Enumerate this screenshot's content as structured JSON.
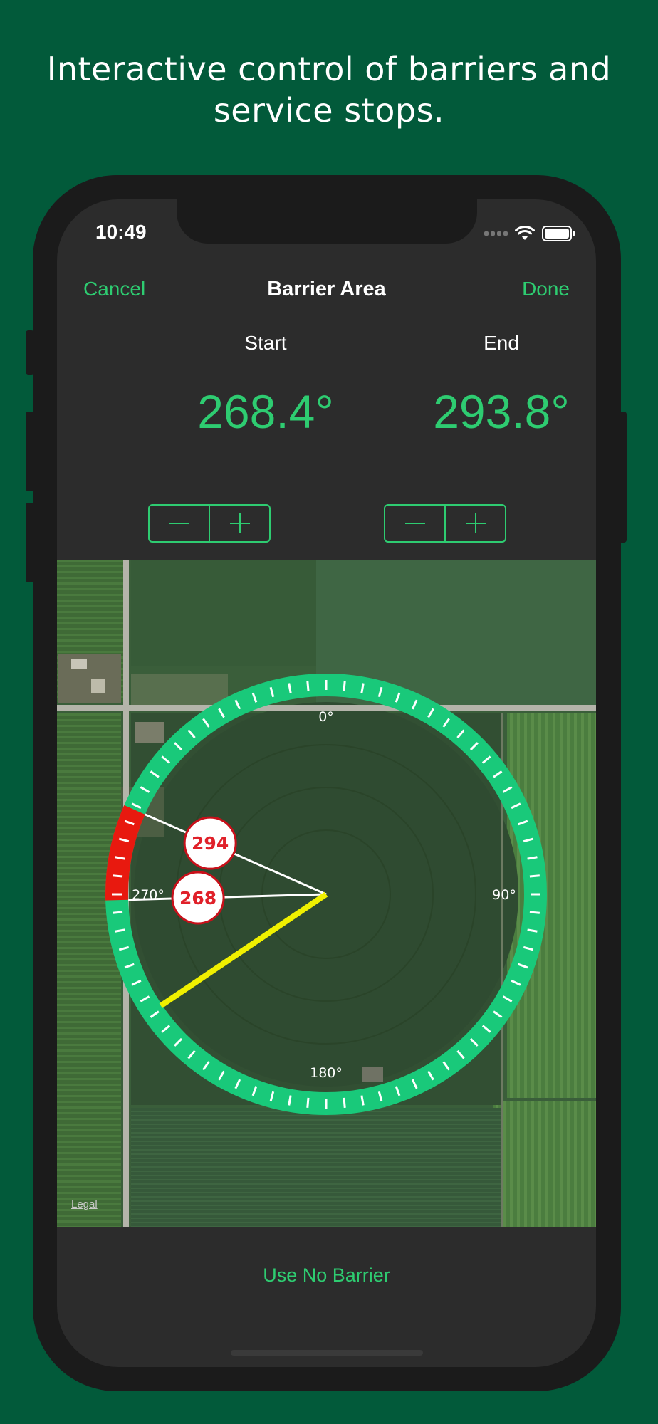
{
  "headline": "Interactive control of barriers and service stops.",
  "status_bar": {
    "time": "10:49"
  },
  "navbar": {
    "cancel": "Cancel",
    "title": "Barrier Area",
    "done": "Done"
  },
  "start": {
    "label": "Start",
    "value": "268.4°"
  },
  "end": {
    "label": "End",
    "value": "293.8°"
  },
  "dial": {
    "label_0": "0°",
    "label_90": "90°",
    "label_180": "180°",
    "label_270": "270°",
    "start_marker": "268",
    "end_marker": "294",
    "current_angle": 236
  },
  "map": {
    "legal": "Legal"
  },
  "bottom_button": "Use No Barrier",
  "colors": {
    "background": "#025a3a",
    "accent": "#2ecc71",
    "ring": "#19c97a",
    "barrier": "#e8190f",
    "pointer": "#f0f000"
  }
}
